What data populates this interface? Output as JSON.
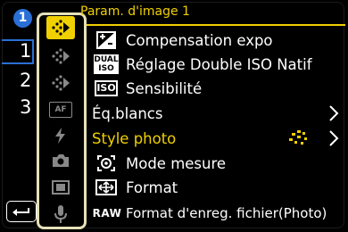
{
  "header": {
    "title": "Param. d'image 1"
  },
  "page_indicator": {
    "badge": "1",
    "pages": [
      "1",
      "2",
      "3"
    ],
    "current": "1"
  },
  "tabs": [
    {
      "name": "image-settings-1",
      "active": true
    },
    {
      "name": "image-settings-2",
      "active": false
    },
    {
      "name": "image-settings-3",
      "active": false
    },
    {
      "name": "af",
      "label": "AF",
      "active": false
    },
    {
      "name": "flash",
      "active": false
    },
    {
      "name": "camera",
      "active": false
    },
    {
      "name": "video",
      "active": false
    },
    {
      "name": "audio",
      "active": false
    }
  ],
  "menu": {
    "items": [
      {
        "icon": "exposure-compensation-icon",
        "label": "Compensation expo"
      },
      {
        "icon": "dual-iso-icon",
        "icon_text": "DUAL ISO",
        "label": "Réglage Double ISO Natif"
      },
      {
        "icon": "iso-icon",
        "icon_text": "ISO",
        "label": "Sensibilité"
      },
      {
        "icon": "",
        "label": "Éq.blancs",
        "chevron": true
      },
      {
        "icon": "",
        "label": "Style photo",
        "chevron": true,
        "selected": true,
        "trailing_icon": "photo-style-icon"
      },
      {
        "icon": "metering-mode-icon",
        "label": "Mode mesure"
      },
      {
        "icon": "format-icon",
        "label": "Format"
      },
      {
        "icon": "raw-format-icon",
        "icon_text": "RAW",
        "label": "Format d'enreg. fichier(Photo)"
      }
    ]
  },
  "colors": {
    "accent": "#f0d000",
    "badge": "#2a6fd6",
    "tab_border": "#e6e0b8"
  }
}
